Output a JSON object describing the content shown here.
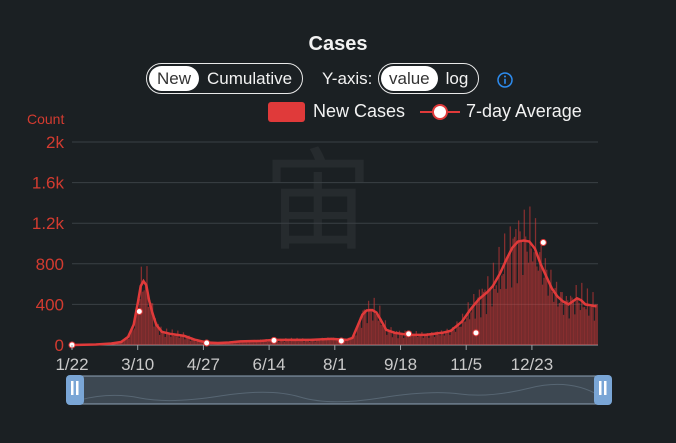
{
  "title": "Cases",
  "mode_toggle": {
    "options": [
      "New",
      "Cumulative"
    ],
    "selected": "New"
  },
  "yaxis_toggle": {
    "label": "Y-axis:",
    "options": [
      "value",
      "log"
    ],
    "selected": "value"
  },
  "info_icon": "info-circle-icon",
  "legend": {
    "new_cases": "New Cases",
    "avg": "7-day Average"
  },
  "colors": {
    "bar": "#e03a3a",
    "line": "#e03a3a",
    "axis_text": "#d33b30",
    "tick_text": "#c9c9c9",
    "grid": "#3a4044"
  },
  "chart_data": {
    "type": "bar",
    "ylabel": "Count",
    "ylim": [
      0,
      2000
    ],
    "yticks": [
      0,
      400,
      800,
      1200,
      1600,
      2000
    ],
    "ytick_labels": [
      "0",
      "400",
      "800",
      "1.2k",
      "1.6k",
      "2k"
    ],
    "xtick_labels": [
      "1/22",
      "3/10",
      "4/27",
      "6/14",
      "8/1",
      "9/18",
      "11/5",
      "12/23"
    ],
    "series": [
      {
        "name": "New Cases",
        "type": "bar"
      },
      {
        "name": "7-day Average",
        "type": "line",
        "points": [
          [
            0,
            0
          ],
          [
            17,
            5
          ],
          [
            28,
            15
          ],
          [
            35,
            30
          ],
          [
            40,
            80
          ],
          [
            44,
            200
          ],
          [
            47,
            420
          ],
          [
            49,
            580
          ],
          [
            51,
            630
          ],
          [
            53,
            590
          ],
          [
            55,
            440
          ],
          [
            57,
            330
          ],
          [
            60,
            200
          ],
          [
            64,
            130
          ],
          [
            70,
            110
          ],
          [
            80,
            90
          ],
          [
            88,
            50
          ],
          [
            96,
            25
          ],
          [
            104,
            20
          ],
          [
            112,
            25
          ],
          [
            120,
            35
          ],
          [
            135,
            40
          ],
          [
            144,
            50
          ],
          [
            155,
            50
          ],
          [
            170,
            50
          ],
          [
            185,
            60
          ],
          [
            196,
            50
          ],
          [
            200,
            70
          ],
          [
            204,
            200
          ],
          [
            207,
            300
          ],
          [
            210,
            340
          ],
          [
            214,
            345
          ],
          [
            217,
            320
          ],
          [
            220,
            250
          ],
          [
            224,
            150
          ],
          [
            230,
            120
          ],
          [
            240,
            100
          ],
          [
            252,
            100
          ],
          [
            264,
            120
          ],
          [
            270,
            140
          ],
          [
            278,
            230
          ],
          [
            284,
            350
          ],
          [
            290,
            450
          ],
          [
            296,
            520
          ],
          [
            300,
            580
          ],
          [
            305,
            700
          ],
          [
            310,
            850
          ],
          [
            314,
            960
          ],
          [
            318,
            1020
          ],
          [
            322,
            1030
          ],
          [
            326,
            1020
          ],
          [
            330,
            950
          ],
          [
            334,
            800
          ],
          [
            338,
            680
          ],
          [
            342,
            560
          ],
          [
            346,
            480
          ],
          [
            350,
            430
          ],
          [
            354,
            400
          ],
          [
            357,
            430
          ],
          [
            360,
            460
          ],
          [
            363,
            440
          ],
          [
            366,
            400
          ],
          [
            370,
            390
          ],
          [
            374,
            380
          ]
        ]
      },
      {
        "name": "markers",
        "points": [
          [
            0,
            0
          ],
          [
            48,
            330
          ],
          [
            96,
            20
          ],
          [
            144,
            45
          ],
          [
            192,
            40
          ],
          [
            240,
            110
          ],
          [
            288,
            120
          ],
          [
            336,
            1010
          ]
        ]
      }
    ],
    "bars_note": "daily values jitter around the 7-day average",
    "x_range": [
      0,
      375
    ],
    "watermark": "宙"
  }
}
